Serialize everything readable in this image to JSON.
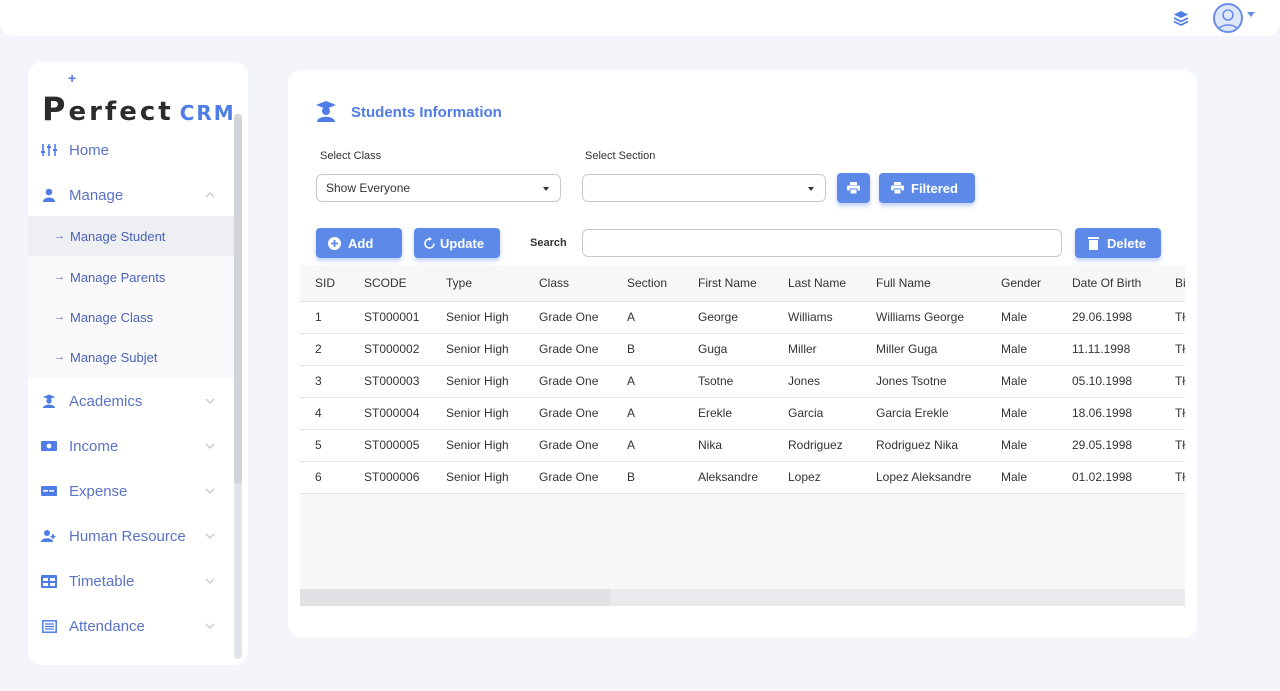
{
  "topbar": {
    "layers_icon": "layers-icon",
    "avatar_icon": "user-avatar-icon"
  },
  "logo": {
    "prefix": "P",
    "rest": "erfect",
    "crm": "CRM",
    "plus": "+"
  },
  "sidebar": {
    "items": [
      {
        "label": "Home",
        "icon": "sliders-icon"
      },
      {
        "label": "Manage",
        "icon": "user-icon",
        "expanded": true
      },
      {
        "label": "Academics",
        "icon": "student-icon"
      },
      {
        "label": "Income",
        "icon": "money-icon"
      },
      {
        "label": "Expense",
        "icon": "card-icon"
      },
      {
        "label": "Human Resource",
        "icon": "user-add-icon"
      },
      {
        "label": "Timetable",
        "icon": "table-icon"
      },
      {
        "label": "Attendance",
        "icon": "list-icon"
      }
    ],
    "subitems": [
      {
        "label": "Manage Student",
        "active": true
      },
      {
        "label": "Manage Parents"
      },
      {
        "label": "Manage Class"
      },
      {
        "label": "Manage Subjet"
      }
    ]
  },
  "panel": {
    "title": "Students Information",
    "select_class_label": "Select Class",
    "select_class_value": "Show Everyone",
    "select_section_label": "Select Section",
    "select_section_value": "",
    "filtered_label": "Filtered",
    "add_label": "Add",
    "update_label": "Update",
    "search_label": "Search",
    "delete_label": "Delete",
    "accent": "#4f7ce6"
  },
  "table": {
    "columns": [
      "SID",
      "SCODE",
      "Type",
      "Class",
      "Section",
      "First Name",
      "Last Name",
      "Full Name",
      "Gender",
      "Date Of Birth",
      "Bi"
    ],
    "rows": [
      [
        "1",
        "ST000001",
        "Senior High",
        "Grade One",
        "A",
        "George",
        "Williams",
        "Williams George",
        "Male",
        "29.06.1998",
        "Tł"
      ],
      [
        "2",
        "ST000002",
        "Senior High",
        "Grade One",
        "B",
        "Guga",
        "Miller",
        "Miller Guga",
        "Male",
        "11.11.1998",
        "Tł"
      ],
      [
        "3",
        "ST000003",
        "Senior High",
        "Grade One",
        "A",
        "Tsotne",
        "Jones",
        "Jones Tsotne",
        "Male",
        "05.10.1998",
        "Tł"
      ],
      [
        "4",
        "ST000004",
        "Senior High",
        "Grade One",
        "A",
        "Erekle",
        "Garcia",
        "Garcia Erekle",
        "Male",
        "18.06.1998",
        "Tł"
      ],
      [
        "5",
        "ST000005",
        "Senior High",
        "Grade One",
        "A",
        "Nika",
        "Rodriguez",
        "Rodriguez Nika",
        "Male",
        "29.05.1998",
        "Tł"
      ],
      [
        "6",
        "ST000006",
        "Senior High",
        "Grade One",
        "B",
        "Aleksandre",
        "Lopez",
        "Lopez Aleksandre",
        "Male",
        "01.02.1998",
        "Tł"
      ]
    ]
  }
}
